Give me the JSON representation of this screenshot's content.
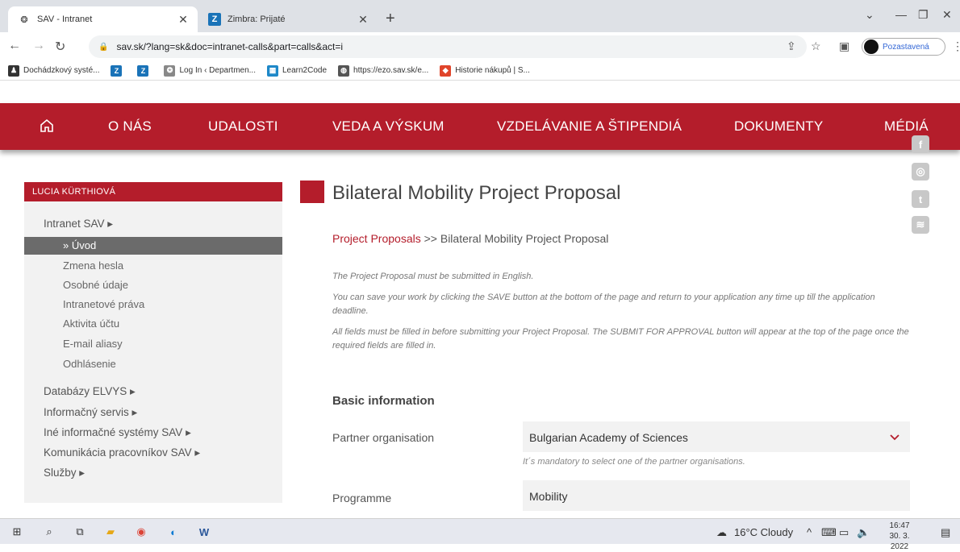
{
  "browser": {
    "tabs": [
      {
        "title": "SAV - Intranet",
        "active": true
      },
      {
        "title": "Zimbra: Prijaté",
        "active": false
      }
    ],
    "url": "sav.sk/?lang=sk&doc=intranet-calls&part=calls&act=i",
    "profile_label": "Pozastavená",
    "bookmarks": [
      {
        "label": "Dochádzkový systé...",
        "icon": "people-icon",
        "color": "#333333"
      },
      {
        "label": "",
        "icon": "zimbra-icon",
        "color": "#1a73b8"
      },
      {
        "label": "",
        "icon": "zimbra-icon",
        "color": "#1a73b8"
      },
      {
        "label": "Log In ‹ Departmen...",
        "icon": "wordpress-icon",
        "color": "#888888"
      },
      {
        "label": "Learn2Code",
        "icon": "learn2code-icon",
        "color": "#1e88c8"
      },
      {
        "label": "https://ezo.sav.sk/e...",
        "icon": "globe-icon",
        "color": "#555555"
      },
      {
        "label": "Historie nákupů | S...",
        "icon": "shop-icon",
        "color": "#e0452b"
      }
    ]
  },
  "nav": {
    "items": [
      "O NÁS",
      "UDALOSTI",
      "VEDA A VÝSKUM",
      "VZDELÁVANIE A ŠTIPENDIÁ",
      "DOKUMENTY",
      "MÉDIÁ"
    ],
    "accent": "#b41d2b"
  },
  "sidebar": {
    "user": "LUCIA KÜRTHIOVÁ",
    "intranet": "Intranet SAV ▸",
    "active": "» Úvod",
    "subitems": [
      "Zmena hesla",
      "Osobné údaje",
      "Intranetové práva",
      "Aktivita účtu",
      "E-mail aliasy",
      "Odhlásenie"
    ],
    "sections": [
      "Databázy ELVYS ▸",
      "Informačný servis ▸",
      "Iné informačné systémy SAV ▸",
      "Komunikácia pracovníkov SAV ▸",
      "Služby ▸"
    ]
  },
  "main": {
    "title": "Bilateral Mobility Project Proposal",
    "breadcrumb_link": "Project Proposals",
    "breadcrumb_rest": " >> Bilateral Mobility Project Proposal",
    "notes": [
      "The Project Proposal must be submitted in English.",
      "You can save your work by clicking the SAVE button at the bottom of the page and return to your application any time up till the application deadline.",
      "All fields must be filled in before submitting your Project Proposal. The SUBMIT FOR APPROVAL button will appear at the top of the page once the required fields are filled in."
    ],
    "section": "Basic information",
    "partner_label": "Partner organisation",
    "partner_value": "Bulgarian Academy of Sciences",
    "partner_hint": "It´s mandatory to select one of the partner organisations.",
    "programme_label": "Programme",
    "programme_value": "Mobility"
  },
  "taskbar": {
    "weather": "16°C  Cloudy",
    "time": "16:47",
    "date": "30. 3. 2022"
  }
}
